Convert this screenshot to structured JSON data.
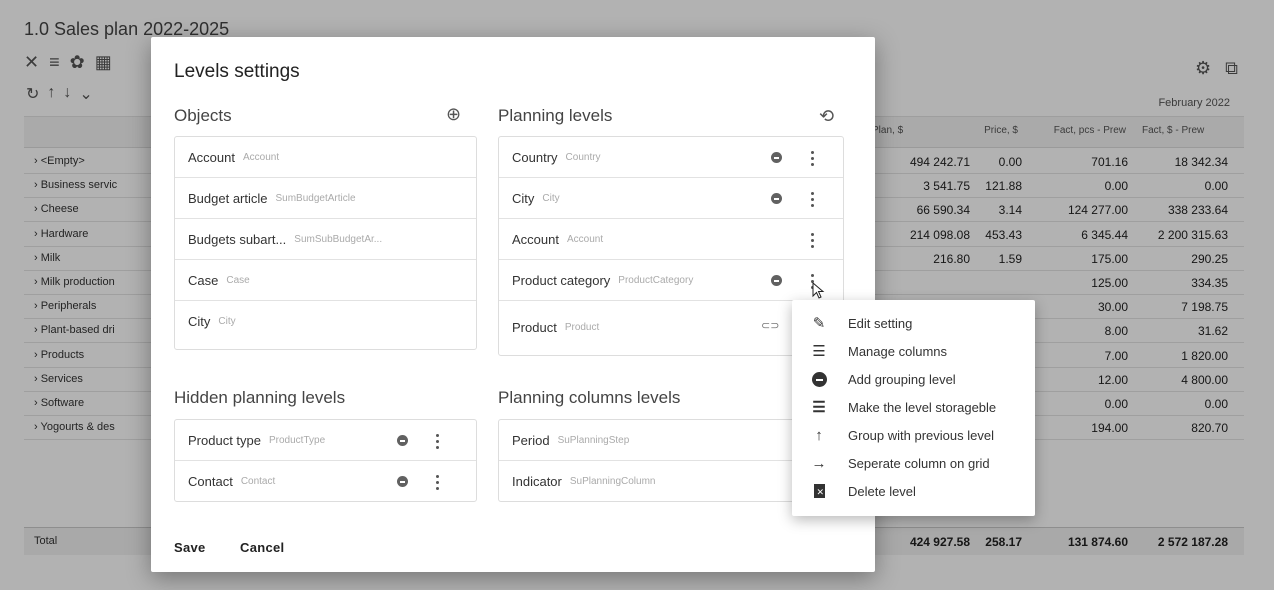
{
  "app": {
    "title": "1.0 Sales plan 2022-2025",
    "toolbar_icons": [
      "close-icon",
      "filter-icon",
      "palette-icon",
      "grid-icon"
    ],
    "toolbar2_icons": [
      "refresh-icon",
      "arrow-up-icon",
      "arrow-down-icon",
      "chevron-down-icon"
    ],
    "right_icons": [
      "gear-icon",
      "external-link-icon"
    ],
    "period_label": "February 2022",
    "columns": [
      "Plan, $",
      "Price, $",
      "Fact, pcs - Prew",
      "Fact, $ - Prew"
    ],
    "rows": [
      {
        "label": "<Empty>",
        "values": [
          "494 242.71",
          "0.00",
          "701.16",
          "18 342.34"
        ]
      },
      {
        "label": "Business servic",
        "values": [
          "3 541.75",
          "121.88",
          "0.00",
          "0.00"
        ]
      },
      {
        "label": "Cheese",
        "values": [
          "66 590.34",
          "3.14",
          "124 277.00",
          "338 233.64"
        ]
      },
      {
        "label": "Hardware",
        "values": [
          "214 098.08",
          "453.43",
          "6 345.44",
          "2 200 315.63"
        ]
      },
      {
        "label": "Milk",
        "values": [
          "216.80",
          "1.59",
          "175.00",
          "290.25"
        ]
      },
      {
        "label": "Milk production",
        "values": [
          "",
          "",
          "125.00",
          "334.35"
        ]
      },
      {
        "label": "Peripherals",
        "values": [
          "",
          "",
          "30.00",
          "7 198.75"
        ]
      },
      {
        "label": "Plant-based dri",
        "values": [
          "",
          "",
          "8.00",
          "31.62"
        ]
      },
      {
        "label": "Products",
        "values": [
          "",
          "",
          "7.00",
          "1 820.00"
        ]
      },
      {
        "label": "Services",
        "values": [
          "",
          "",
          "12.00",
          "4 800.00"
        ]
      },
      {
        "label": "Software",
        "values": [
          "",
          "",
          "0.00",
          "0.00"
        ]
      },
      {
        "label": "Yogourts & des",
        "values": [
          "",
          "",
          "194.00",
          "820.70"
        ]
      }
    ],
    "total": {
      "label": "Total",
      "values": [
        "424 927.58",
        "258.17",
        "131 874.60",
        "2 572 187.28"
      ]
    }
  },
  "dialog": {
    "title": "Levels settings",
    "objects": {
      "title": "Objects",
      "items": [
        {
          "name": "Account",
          "code": "Account"
        },
        {
          "name": "Budget article",
          "code": "SumBudgetArticle"
        },
        {
          "name": "Budgets subart...",
          "code": "SumSubBudgetAr..."
        },
        {
          "name": "Case",
          "code": "Case"
        },
        {
          "name": "City",
          "code": "City"
        }
      ]
    },
    "planning_levels": {
      "title": "Planning levels",
      "items": [
        {
          "name": "Country",
          "code": "Country"
        },
        {
          "name": "City",
          "code": "City"
        },
        {
          "name": "Account",
          "code": "Account"
        },
        {
          "name": "Product category",
          "code": "ProductCategory"
        },
        {
          "name": "Product",
          "code": "Product"
        }
      ]
    },
    "hidden_levels": {
      "title": "Hidden planning levels",
      "items": [
        {
          "name": "Product type",
          "code": "ProductType"
        },
        {
          "name": "Contact",
          "code": "Contact"
        }
      ]
    },
    "columns_levels": {
      "title": "Planning columns levels",
      "items": [
        {
          "name": "Period",
          "code": "SuPlanningStep"
        },
        {
          "name": "Indicator",
          "code": "SuPlanningColumn"
        }
      ]
    },
    "save_label": "Save",
    "cancel_label": "Cancel"
  },
  "context_menu": {
    "items": [
      {
        "label": "Edit setting",
        "icon": "pencil-icon"
      },
      {
        "label": "Manage columns",
        "icon": "list-icon"
      },
      {
        "label": "Add grouping level",
        "icon": "minus-circle-icon"
      },
      {
        "label": "Make the level storageble",
        "icon": "storage-list-icon"
      },
      {
        "label": "Group with previous level",
        "icon": "arrow-up-icon"
      },
      {
        "label": "Seperate column on grid",
        "icon": "arrow-right-icon"
      },
      {
        "label": "Delete level",
        "icon": "trash-icon"
      }
    ]
  }
}
